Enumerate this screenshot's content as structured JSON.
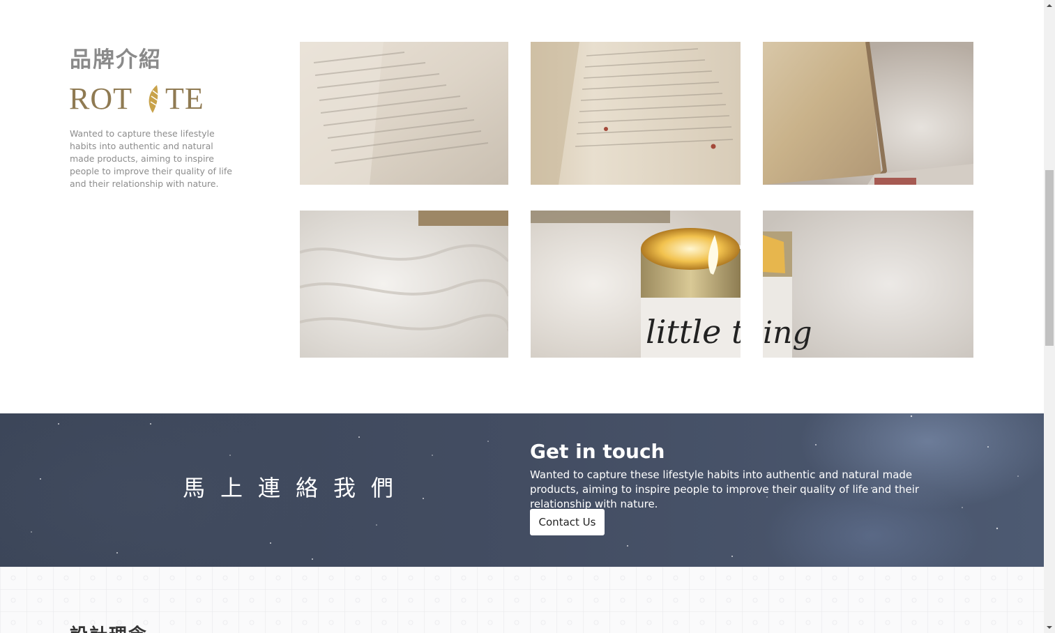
{
  "brand": {
    "title": "品牌介紹",
    "logo_text": "ROTATE",
    "description": "Wanted to capture these lifestyle habits into authentic and natural made products, aiming to inspire people to improve their quality of life and their relationship with nature.",
    "photos": [
      {
        "name": "open-book-photo-1",
        "subject": "open book pages"
      },
      {
        "name": "open-book-photo-2",
        "subject": "open book pages close-up"
      },
      {
        "name": "book-on-fur-photo",
        "subject": "book on fur blanket"
      },
      {
        "name": "fur-blanket-photo",
        "subject": "white fur blanket"
      },
      {
        "name": "candle-photo",
        "subject": "lit candle on fur blanket"
      },
      {
        "name": "candle-edge-photo",
        "subject": "candle edge on fur blanket"
      }
    ]
  },
  "contact": {
    "chinese_title": "馬上連絡我們",
    "heading": "Get in touch",
    "text": "Wanted to capture these lifestyle habits into authentic and natural made products, aiming to inspire people to improve their quality of life and their relationship with nature.",
    "button_label": "Contact Us"
  },
  "concept": {
    "title": "設計理念"
  },
  "colors": {
    "brand_gold": "#8f7a52",
    "contact_bg": "#434d62",
    "gray_text": "#8c8c8c"
  }
}
